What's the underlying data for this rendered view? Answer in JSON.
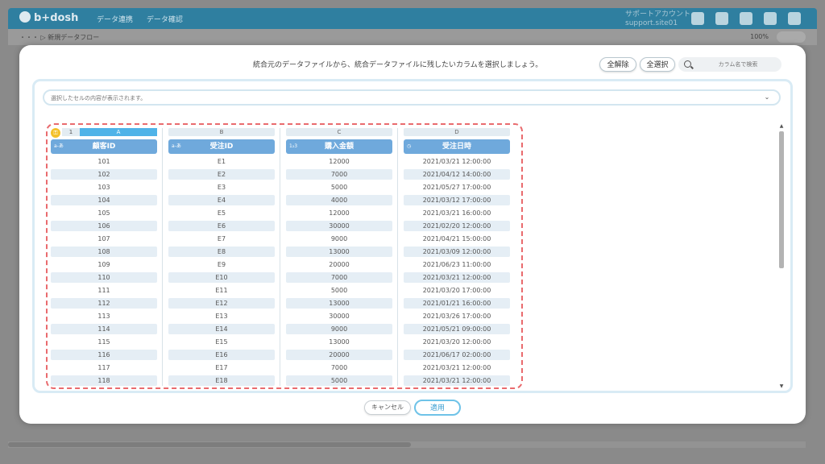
{
  "app": {
    "logo": "b+dosh",
    "nav": [
      "データ連携",
      "データ確認"
    ],
    "account_name": "サポートアカウント",
    "account_id": "support.site01",
    "breadcrumb": "・・・  ▷ 新規データフロー",
    "zoom": "100%"
  },
  "modal": {
    "instruction": "統合元のデータファイルから、統合データファイルに残したいカラムを選択しましょう。",
    "deselect_all": "全解除",
    "select_all": "全選択",
    "search_placeholder": "カラム名で検索",
    "cell_preview_placeholder": "選択したセルの内容が表示されます。",
    "cancel": "キャンセル",
    "apply": "適用"
  },
  "grid": {
    "row_number": "1",
    "columns": [
      {
        "letter": "A",
        "name": "顧客ID",
        "type_icon": "a-あ",
        "values": [
          "101",
          "102",
          "103",
          "104",
          "105",
          "106",
          "107",
          "108",
          "109",
          "110",
          "111",
          "112",
          "113",
          "114",
          "115",
          "116",
          "117",
          "118"
        ]
      },
      {
        "letter": "B",
        "name": "受注ID",
        "type_icon": "a-あ",
        "values": [
          "E1",
          "E2",
          "E3",
          "E4",
          "E5",
          "E6",
          "E7",
          "E8",
          "E9",
          "E10",
          "E11",
          "E12",
          "E13",
          "E14",
          "E15",
          "E16",
          "E17",
          "E18"
        ]
      },
      {
        "letter": "C",
        "name": "購入金額",
        "type_icon": "1₂3",
        "values": [
          "12000",
          "7000",
          "5000",
          "4000",
          "12000",
          "30000",
          "9000",
          "13000",
          "20000",
          "7000",
          "5000",
          "13000",
          "30000",
          "9000",
          "13000",
          "20000",
          "7000",
          "5000"
        ]
      },
      {
        "letter": "D",
        "name": "受注日時",
        "type_icon": "clock-icon",
        "values": [
          "2021/03/21 12:00:00",
          "2021/04/12 14:00:00",
          "2021/05/27 17:00:00",
          "2021/03/12 17:00:00",
          "2021/03/21 16:00:00",
          "2021/02/20 12:00:00",
          "2021/04/21 15:00:00",
          "2021/03/09 12:00:00",
          "2021/06/23 11:00:00",
          "2021/03/21 12:00:00",
          "2021/03/20 17:00:00",
          "2021/01/21 16:00:00",
          "2021/03/26 17:00:00",
          "2021/05/21 09:00:00",
          "2021/03/20 12:00:00",
          "2021/06/17 02:00:00",
          "2021/03/21 12:00:00",
          "2021/03/21 12:00:00"
        ]
      }
    ]
  },
  "colors": {
    "header": "#6fa9dc",
    "selection_outline": "#e96b6e",
    "key": "#f4c12a"
  }
}
